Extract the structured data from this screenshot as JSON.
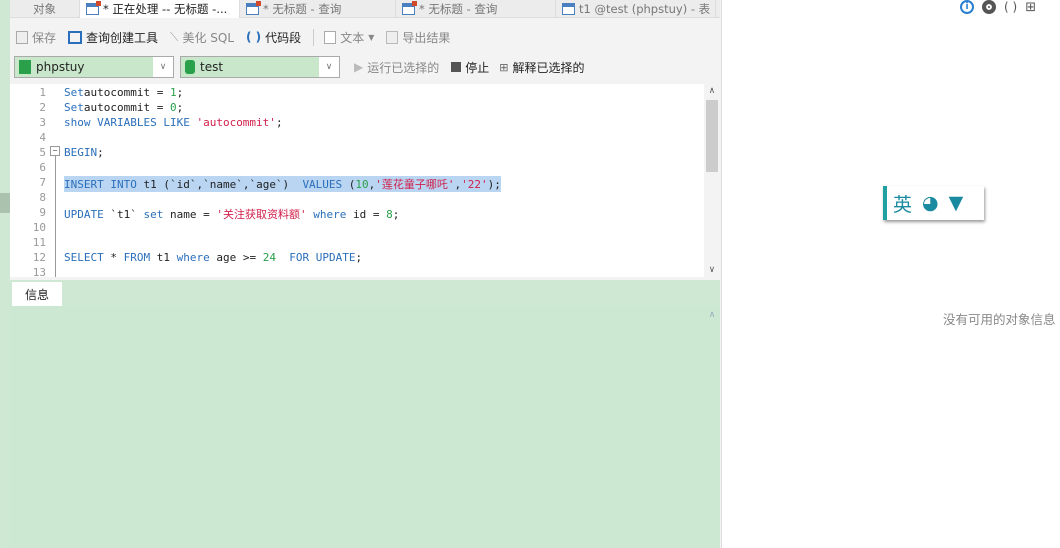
{
  "tabs": [
    {
      "label": "对象",
      "icon": "none",
      "active": false
    },
    {
      "label": "* 正在处理 -- 无标题 -...",
      "icon": "query-icon",
      "active": true
    },
    {
      "label": "* 无标题 - 查询",
      "icon": "query-icon",
      "active": false
    },
    {
      "label": "* 无标题 - 查询",
      "icon": "query-icon",
      "active": false
    },
    {
      "label": "t1 @test (phpstuy) - 表",
      "icon": "table-icon",
      "active": false
    }
  ],
  "toolbar": {
    "save": "保存",
    "query_builder": "查询创建工具",
    "beautify": "美化 SQL",
    "snippet": "代码段",
    "text": "文本",
    "export": "导出结果"
  },
  "selectors": {
    "connection": "phpstuy",
    "database": "test"
  },
  "actions": {
    "run_selected": "运行已选择的",
    "stop": "停止",
    "explain_selected": "解释已选择的"
  },
  "editor": {
    "line_numbers": [
      "1",
      "2",
      "3",
      "4",
      "5",
      "6",
      "7",
      "8",
      "9",
      "10",
      "11",
      "12",
      "13"
    ],
    "lines": [
      [
        [
          "kw",
          "Set"
        ],
        [
          "",
          "autocommit = "
        ],
        [
          "num",
          "1"
        ],
        [
          "",
          ";"
        ]
      ],
      [
        [
          "kw",
          "Set"
        ],
        [
          "",
          "autocommit = "
        ],
        [
          "num",
          "0"
        ],
        [
          "",
          ";"
        ]
      ],
      [
        [
          "kw",
          "show VARIABLES LIKE "
        ],
        [
          "str",
          "'autocommit'"
        ],
        [
          "",
          ";"
        ]
      ],
      [],
      [
        [
          "kw",
          "BEGIN"
        ],
        [
          "",
          ";"
        ]
      ],
      [],
      [
        [
          "kw",
          "INSERT INTO "
        ],
        [
          "",
          "t1 (`id`,`name`,`age`)  "
        ],
        [
          "kw",
          "VALUES "
        ],
        [
          "",
          "("
        ],
        [
          "num",
          "10"
        ],
        [
          "",
          ","
        ],
        [
          "str",
          "'莲花童子哪吒'"
        ],
        [
          "",
          ","
        ],
        [
          "str",
          "'22'"
        ],
        [
          "",
          ");"
        ]
      ],
      [],
      [
        [
          "kw",
          "UPDATE "
        ],
        [
          "",
          "`t1` "
        ],
        [
          "kw",
          "set "
        ],
        [
          "",
          "name = "
        ],
        [
          "str",
          "'关注获取资料额'"
        ],
        [
          "kw",
          " where "
        ],
        [
          "",
          "id = "
        ],
        [
          "num",
          "8"
        ],
        [
          "",
          ";"
        ]
      ],
      [],
      [],
      [
        [
          "kw",
          "SELECT "
        ],
        [
          "",
          "* "
        ],
        [
          "kw",
          "FROM "
        ],
        [
          "",
          "t1 "
        ],
        [
          "kw",
          "where "
        ],
        [
          "",
          "age >= "
        ],
        [
          "num",
          "24"
        ],
        [
          "kw",
          "  FOR UPDATE"
        ],
        [
          "",
          ";"
        ]
      ],
      []
    ],
    "selected_line": 7
  },
  "info_tab": "信息",
  "ime": {
    "lang": "英"
  },
  "right_panel": {
    "empty_text": "没有可用的对象信息"
  }
}
